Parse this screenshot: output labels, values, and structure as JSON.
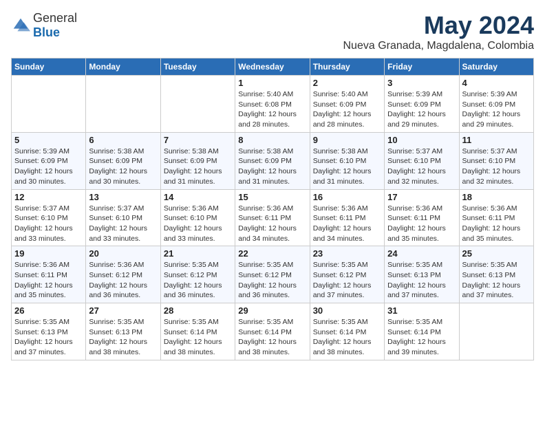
{
  "header": {
    "logo": {
      "general": "General",
      "blue": "Blue"
    },
    "title": "May 2024",
    "subtitle": "Nueva Granada, Magdalena, Colombia"
  },
  "weekdays": [
    "Sunday",
    "Monday",
    "Tuesday",
    "Wednesday",
    "Thursday",
    "Friday",
    "Saturday"
  ],
  "weeks": [
    [
      {
        "day": "",
        "sunrise": "",
        "sunset": "",
        "daylight": ""
      },
      {
        "day": "",
        "sunrise": "",
        "sunset": "",
        "daylight": ""
      },
      {
        "day": "",
        "sunrise": "",
        "sunset": "",
        "daylight": ""
      },
      {
        "day": "1",
        "sunrise": "Sunrise: 5:40 AM",
        "sunset": "Sunset: 6:08 PM",
        "daylight": "Daylight: 12 hours and 28 minutes."
      },
      {
        "day": "2",
        "sunrise": "Sunrise: 5:40 AM",
        "sunset": "Sunset: 6:09 PM",
        "daylight": "Daylight: 12 hours and 28 minutes."
      },
      {
        "day": "3",
        "sunrise": "Sunrise: 5:39 AM",
        "sunset": "Sunset: 6:09 PM",
        "daylight": "Daylight: 12 hours and 29 minutes."
      },
      {
        "day": "4",
        "sunrise": "Sunrise: 5:39 AM",
        "sunset": "Sunset: 6:09 PM",
        "daylight": "Daylight: 12 hours and 29 minutes."
      }
    ],
    [
      {
        "day": "5",
        "sunrise": "Sunrise: 5:39 AM",
        "sunset": "Sunset: 6:09 PM",
        "daylight": "Daylight: 12 hours and 30 minutes."
      },
      {
        "day": "6",
        "sunrise": "Sunrise: 5:38 AM",
        "sunset": "Sunset: 6:09 PM",
        "daylight": "Daylight: 12 hours and 30 minutes."
      },
      {
        "day": "7",
        "sunrise": "Sunrise: 5:38 AM",
        "sunset": "Sunset: 6:09 PM",
        "daylight": "Daylight: 12 hours and 31 minutes."
      },
      {
        "day": "8",
        "sunrise": "Sunrise: 5:38 AM",
        "sunset": "Sunset: 6:09 PM",
        "daylight": "Daylight: 12 hours and 31 minutes."
      },
      {
        "day": "9",
        "sunrise": "Sunrise: 5:38 AM",
        "sunset": "Sunset: 6:10 PM",
        "daylight": "Daylight: 12 hours and 31 minutes."
      },
      {
        "day": "10",
        "sunrise": "Sunrise: 5:37 AM",
        "sunset": "Sunset: 6:10 PM",
        "daylight": "Daylight: 12 hours and 32 minutes."
      },
      {
        "day": "11",
        "sunrise": "Sunrise: 5:37 AM",
        "sunset": "Sunset: 6:10 PM",
        "daylight": "Daylight: 12 hours and 32 minutes."
      }
    ],
    [
      {
        "day": "12",
        "sunrise": "Sunrise: 5:37 AM",
        "sunset": "Sunset: 6:10 PM",
        "daylight": "Daylight: 12 hours and 33 minutes."
      },
      {
        "day": "13",
        "sunrise": "Sunrise: 5:37 AM",
        "sunset": "Sunset: 6:10 PM",
        "daylight": "Daylight: 12 hours and 33 minutes."
      },
      {
        "day": "14",
        "sunrise": "Sunrise: 5:36 AM",
        "sunset": "Sunset: 6:10 PM",
        "daylight": "Daylight: 12 hours and 33 minutes."
      },
      {
        "day": "15",
        "sunrise": "Sunrise: 5:36 AM",
        "sunset": "Sunset: 6:11 PM",
        "daylight": "Daylight: 12 hours and 34 minutes."
      },
      {
        "day": "16",
        "sunrise": "Sunrise: 5:36 AM",
        "sunset": "Sunset: 6:11 PM",
        "daylight": "Daylight: 12 hours and 34 minutes."
      },
      {
        "day": "17",
        "sunrise": "Sunrise: 5:36 AM",
        "sunset": "Sunset: 6:11 PM",
        "daylight": "Daylight: 12 hours and 35 minutes."
      },
      {
        "day": "18",
        "sunrise": "Sunrise: 5:36 AM",
        "sunset": "Sunset: 6:11 PM",
        "daylight": "Daylight: 12 hours and 35 minutes."
      }
    ],
    [
      {
        "day": "19",
        "sunrise": "Sunrise: 5:36 AM",
        "sunset": "Sunset: 6:11 PM",
        "daylight": "Daylight: 12 hours and 35 minutes."
      },
      {
        "day": "20",
        "sunrise": "Sunrise: 5:36 AM",
        "sunset": "Sunset: 6:12 PM",
        "daylight": "Daylight: 12 hours and 36 minutes."
      },
      {
        "day": "21",
        "sunrise": "Sunrise: 5:35 AM",
        "sunset": "Sunset: 6:12 PM",
        "daylight": "Daylight: 12 hours and 36 minutes."
      },
      {
        "day": "22",
        "sunrise": "Sunrise: 5:35 AM",
        "sunset": "Sunset: 6:12 PM",
        "daylight": "Daylight: 12 hours and 36 minutes."
      },
      {
        "day": "23",
        "sunrise": "Sunrise: 5:35 AM",
        "sunset": "Sunset: 6:12 PM",
        "daylight": "Daylight: 12 hours and 37 minutes."
      },
      {
        "day": "24",
        "sunrise": "Sunrise: 5:35 AM",
        "sunset": "Sunset: 6:13 PM",
        "daylight": "Daylight: 12 hours and 37 minutes."
      },
      {
        "day": "25",
        "sunrise": "Sunrise: 5:35 AM",
        "sunset": "Sunset: 6:13 PM",
        "daylight": "Daylight: 12 hours and 37 minutes."
      }
    ],
    [
      {
        "day": "26",
        "sunrise": "Sunrise: 5:35 AM",
        "sunset": "Sunset: 6:13 PM",
        "daylight": "Daylight: 12 hours and 37 minutes."
      },
      {
        "day": "27",
        "sunrise": "Sunrise: 5:35 AM",
        "sunset": "Sunset: 6:13 PM",
        "daylight": "Daylight: 12 hours and 38 minutes."
      },
      {
        "day": "28",
        "sunrise": "Sunrise: 5:35 AM",
        "sunset": "Sunset: 6:14 PM",
        "daylight": "Daylight: 12 hours and 38 minutes."
      },
      {
        "day": "29",
        "sunrise": "Sunrise: 5:35 AM",
        "sunset": "Sunset: 6:14 PM",
        "daylight": "Daylight: 12 hours and 38 minutes."
      },
      {
        "day": "30",
        "sunrise": "Sunrise: 5:35 AM",
        "sunset": "Sunset: 6:14 PM",
        "daylight": "Daylight: 12 hours and 38 minutes."
      },
      {
        "day": "31",
        "sunrise": "Sunrise: 5:35 AM",
        "sunset": "Sunset: 6:14 PM",
        "daylight": "Daylight: 12 hours and 39 minutes."
      },
      {
        "day": "",
        "sunrise": "",
        "sunset": "",
        "daylight": ""
      }
    ]
  ]
}
